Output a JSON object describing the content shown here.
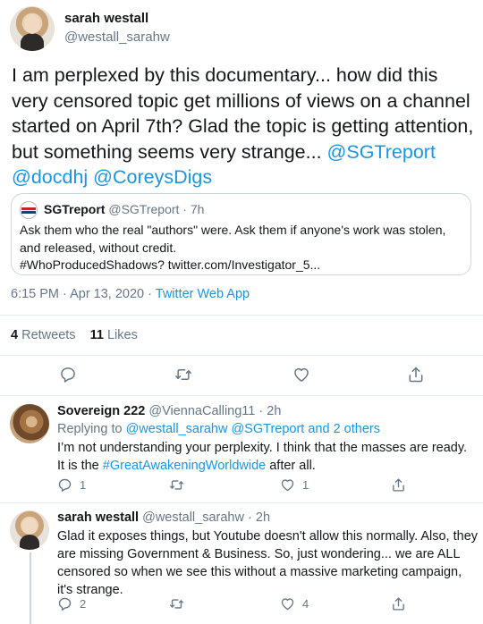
{
  "main_tweet": {
    "author_name": "sarah westall",
    "author_handle": "@westall_sarahw",
    "text_plain": "I am perplexed by this documentary... how did this very censored topic get millions of views on a channel started on April 7th?  Glad the topic is getting attention, but something seems very strange... ",
    "mention1": "@SGTreport",
    "mention2": "@docdhj",
    "mention3": "@CoreysDigs",
    "quoted": {
      "author_name": "SGTreport",
      "author_handle": "@SGTreport",
      "time": "7h",
      "text": "Ask them who the real \"authors\" were.  Ask them if anyone's work was stolen, and released, without credit.",
      "hashtag": "#WhoProducedShadows?",
      "url": "twitter.com/Investigator_5..."
    },
    "timestamp": "6:15 PM · Apr 13, 2020",
    "source": "Twitter Web App",
    "retweets_count": "4",
    "retweets_label": "Retweets",
    "likes_count": "11",
    "likes_label": "Likes"
  },
  "reply1": {
    "author_name": "Sovereign 222",
    "author_handle": "@ViennaCalling11",
    "time": "2h",
    "replying_to_label": "Replying to",
    "replying_to_users": "@westall_sarahw @SGTreport and 2 others",
    "text": "I’m not understanding your perplexity.  I think that the masses are ready. It is the ",
    "hashtag": "#GreatAwakeningWorldwide",
    "text_after": " after all.",
    "reply_count": "1",
    "retweet_count": "",
    "like_count": "1"
  },
  "reply2": {
    "author_name": "sarah westall",
    "author_handle": "@westall_sarahw",
    "time": "2h",
    "text": "Glad it exposes things, but Youtube doesn't allow this normally. Also, they are missing Government & Business. So, just wondering... we are ALL censored so when we see this without a massive marketing campaign, it's strange.",
    "reply_count": "2",
    "retweet_count": "",
    "like_count": "4"
  },
  "colors": {
    "link": "#1b95e0",
    "muted": "#657786",
    "text": "#14171a",
    "border": "#e6ecf0"
  },
  "icons": [
    "reply-icon",
    "retweet-icon",
    "like-icon",
    "share-icon"
  ]
}
